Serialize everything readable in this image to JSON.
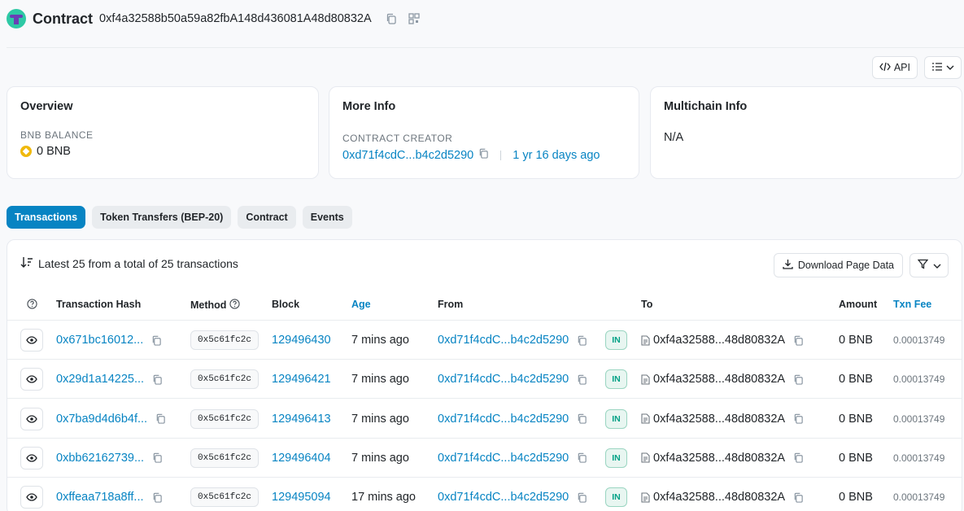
{
  "header": {
    "title": "Contract",
    "address": "0xf4a32588b50a59a82fbA148d436081A48d80832A"
  },
  "toolbar": {
    "api_label": "API"
  },
  "cards": {
    "overview": {
      "title": "Overview",
      "label": "BNB BALANCE",
      "value": "0 BNB"
    },
    "more_info": {
      "title": "More Info",
      "label": "CONTRACT CREATOR",
      "creator": "0xd71f4cdC...b4c2d5290",
      "age": "1 yr 16 days ago"
    },
    "multichain": {
      "title": "Multichain Info",
      "value": "N/A"
    }
  },
  "tabs": [
    "Transactions",
    "Token Transfers (BEP-20)",
    "Contract",
    "Events"
  ],
  "panel": {
    "summary": "Latest 25 from a total of 25 transactions",
    "download_label": "Download Page Data"
  },
  "columns": {
    "hash": "Transaction Hash",
    "method": "Method",
    "block": "Block",
    "age": "Age",
    "from": "From",
    "to": "To",
    "amount": "Amount",
    "fee": "Txn Fee"
  },
  "rows": [
    {
      "hash": "0x671bc16012...",
      "method": "0x5c61fc2c",
      "block": "129496430",
      "age": "7 mins ago",
      "from": "0xd71f4cdC...b4c2d5290",
      "dir": "IN",
      "to": "0xf4a32588...48d80832A",
      "amount": "0 BNB",
      "fee": "0.00013749"
    },
    {
      "hash": "0x29d1a14225...",
      "method": "0x5c61fc2c",
      "block": "129496421",
      "age": "7 mins ago",
      "from": "0xd71f4cdC...b4c2d5290",
      "dir": "IN",
      "to": "0xf4a32588...48d80832A",
      "amount": "0 BNB",
      "fee": "0.00013749"
    },
    {
      "hash": "0x7ba9d4d6b4f...",
      "method": "0x5c61fc2c",
      "block": "129496413",
      "age": "7 mins ago",
      "from": "0xd71f4cdC...b4c2d5290",
      "dir": "IN",
      "to": "0xf4a32588...48d80832A",
      "amount": "0 BNB",
      "fee": "0.00013749"
    },
    {
      "hash": "0xbb62162739...",
      "method": "0x5c61fc2c",
      "block": "129496404",
      "age": "7 mins ago",
      "from": "0xd71f4cdC...b4c2d5290",
      "dir": "IN",
      "to": "0xf4a32588...48d80832A",
      "amount": "0 BNB",
      "fee": "0.00013749"
    },
    {
      "hash": "0xffeaa718a8ff...",
      "method": "0x5c61fc2c",
      "block": "129495094",
      "age": "17 mins ago",
      "from": "0xd71f4cdC...b4c2d5290",
      "dir": "IN",
      "to": "0xf4a32588...48d80832A",
      "amount": "0 BNB",
      "fee": "0.00013749"
    }
  ]
}
